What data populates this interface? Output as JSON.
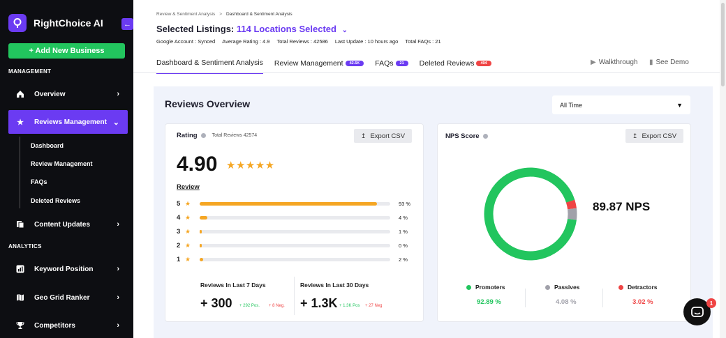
{
  "sidebar": {
    "brand": "RightChoice AI",
    "add_business": "+ Add New Business",
    "section_management": "MANAGEMENT",
    "section_analytics": "ANALYTICS",
    "items": [
      {
        "label": "Overview",
        "icon": "home-icon"
      },
      {
        "label": "Reviews Management",
        "icon": "star-icon"
      },
      {
        "label": "Content Updates",
        "icon": "document-icon"
      },
      {
        "label": "Keyword Position",
        "icon": "chart-icon"
      },
      {
        "label": "Geo Grid Ranker",
        "icon": "map-icon"
      },
      {
        "label": "Competitors",
        "icon": "trophy-icon"
      }
    ],
    "sub_items": [
      "Dashboard",
      "Review Management",
      "FAQs",
      "Deleted Reviews"
    ]
  },
  "breadcrumb": [
    "Review & Sentiment Analysis",
    "Dashboard & Sentiment Analysis"
  ],
  "header": {
    "title_prefix": "Selected Listings:",
    "title_value": "114 Locations Selected",
    "meta": [
      "Google Account : Synced",
      "Average Rating : 4.9",
      "Total Reviews : 42586",
      "Last Update : 10 hours ago",
      "Total FAQs : 21"
    ]
  },
  "tabs": [
    {
      "label": "Dashboard & Sentiment Analysis",
      "badge": ""
    },
    {
      "label": "Review Management",
      "badge": "42.5K"
    },
    {
      "label": "FAQs",
      "badge": "21"
    },
    {
      "label": "Deleted Reviews",
      "badge": "494"
    }
  ],
  "tab_actions": {
    "walkthrough": "Walkthrough",
    "see_demo": "See Demo"
  },
  "overview": {
    "title": "Reviews Overview",
    "period": "All Time"
  },
  "rating_card": {
    "title": "Rating",
    "total_reviews": "Total Reviews 42574",
    "export": "Export CSV",
    "rating": "4.90",
    "stars": "★★★★★",
    "review_link": "Review",
    "distribution": [
      {
        "star": "5",
        "percent": 93,
        "label": "93 %"
      },
      {
        "star": "4",
        "percent": 4,
        "label": "4 %"
      },
      {
        "star": "3",
        "percent": 1,
        "label": "1 %"
      },
      {
        "star": "2",
        "percent": 0,
        "label": "0 %"
      },
      {
        "star": "1",
        "percent": 2,
        "label": "2 %"
      }
    ],
    "last7": {
      "label": "Reviews In Last 7 Days",
      "value": "+ 300",
      "pos": "+ 292 Pos.",
      "neg": "+ 8 Neg."
    },
    "last30": {
      "label": "Reviews In Last 30 Days",
      "value": "+ 1.3K",
      "pos": "+ 1.3K Pos",
      "neg": "+ 27 Neg"
    }
  },
  "nps_card": {
    "title": "NPS Score",
    "export": "Export CSV",
    "value": "89.87 NPS",
    "segments": [
      {
        "name": "Promoters",
        "percent": 92.89,
        "label": "92.89 %",
        "color": "#22c55e"
      },
      {
        "name": "Passives",
        "percent": 4.08,
        "label": "4.08 %",
        "color": "#a1a1aa"
      },
      {
        "name": "Detractors",
        "percent": 3.02,
        "label": "3.02 %",
        "color": "#ef4444"
      }
    ]
  },
  "chat": {
    "badge": "1"
  },
  "colors": {
    "accent": "#6b3bf2",
    "sidebar": "#0d0e12",
    "success": "#22c55e",
    "danger": "#ef4444",
    "star": "#f5a623"
  }
}
